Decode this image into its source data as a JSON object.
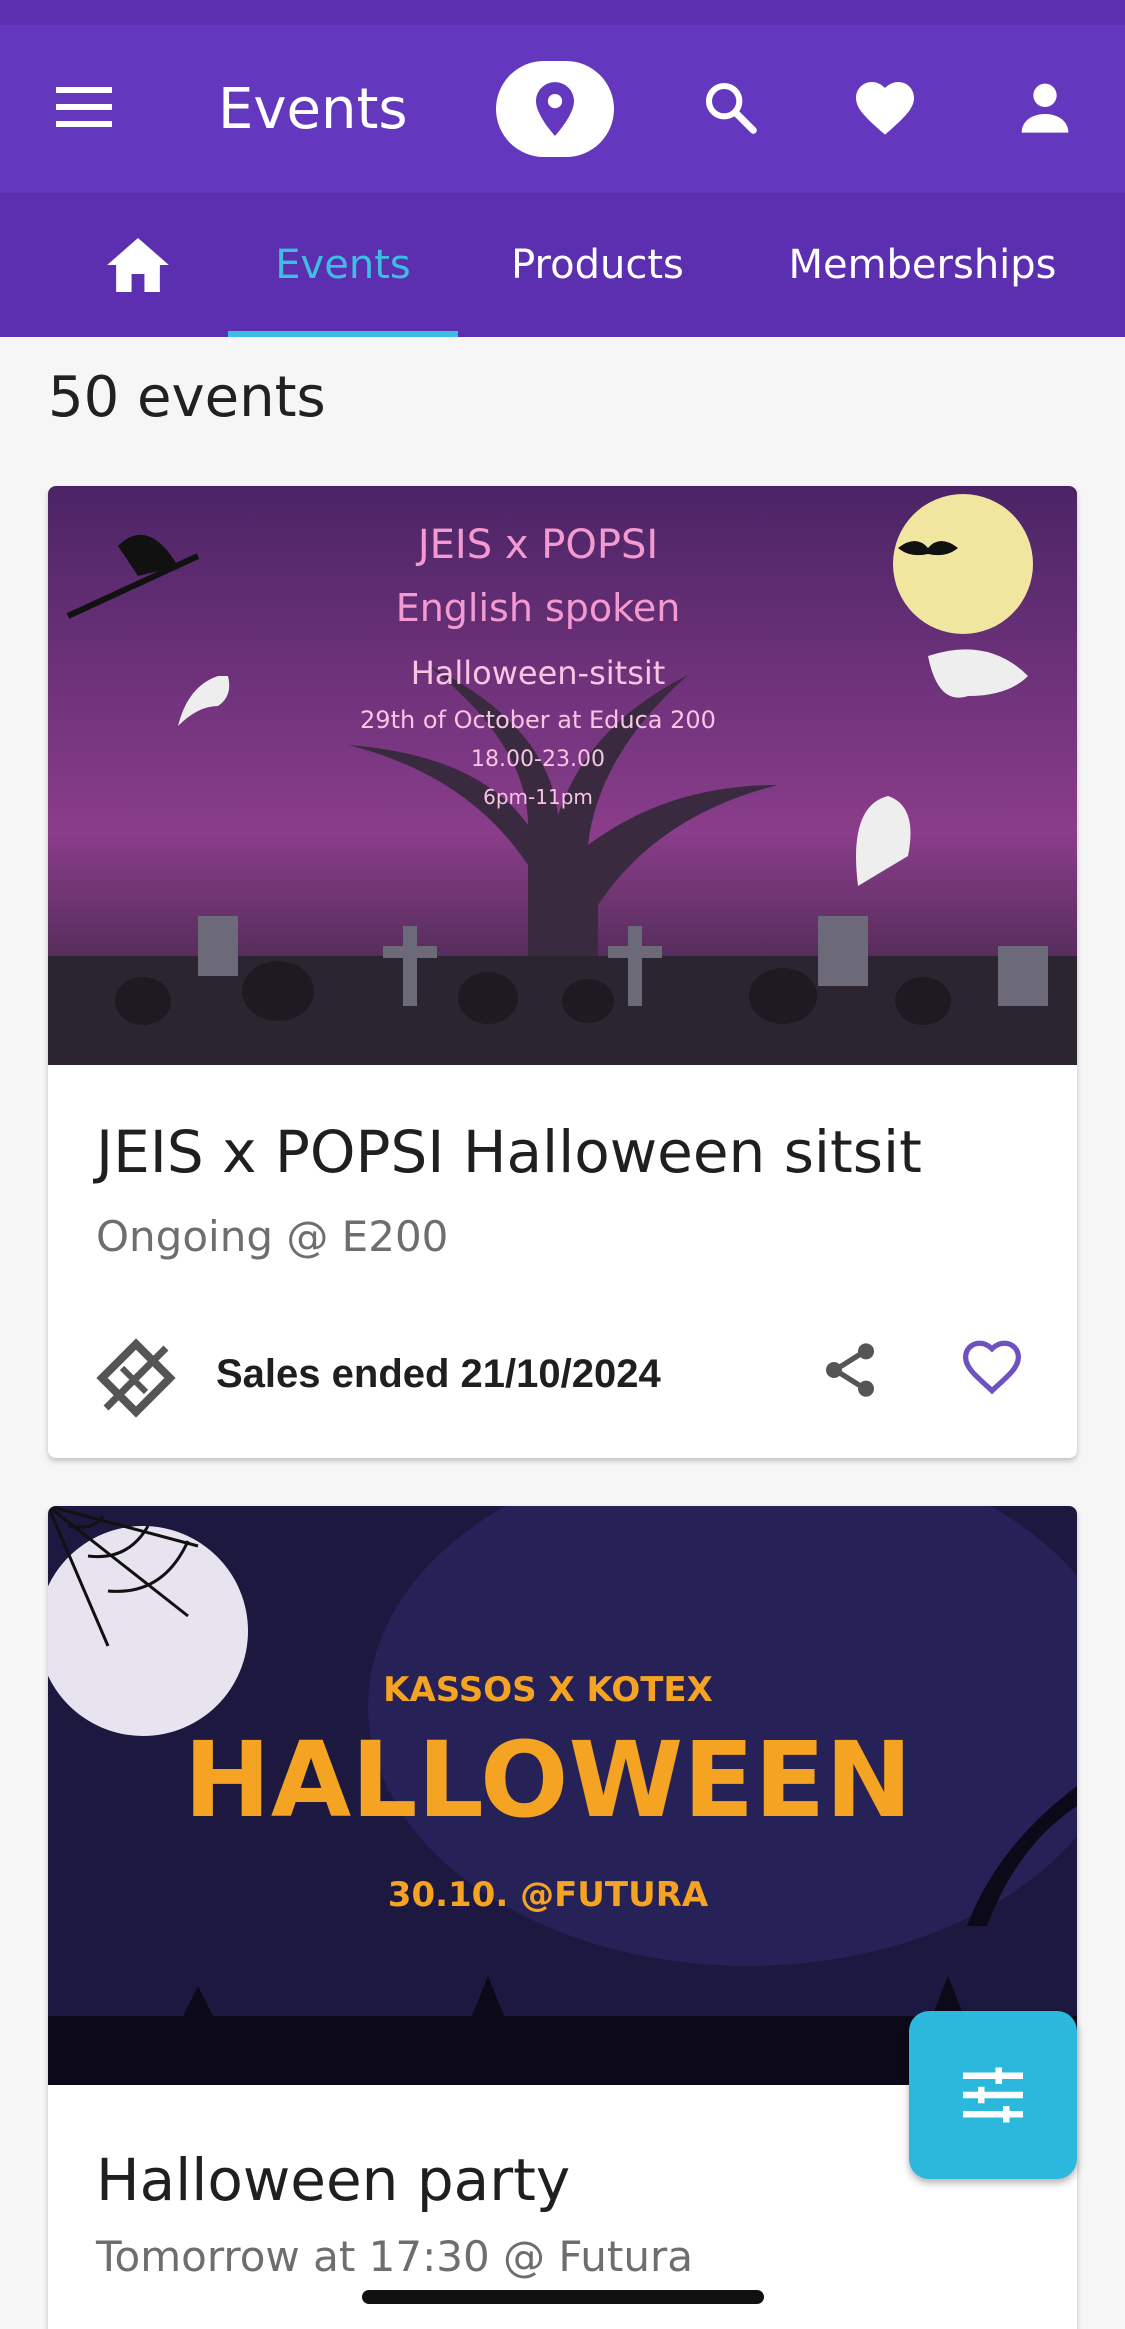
{
  "appbar": {
    "title": "Events",
    "icons": [
      "menu-icon",
      "location-pin-icon",
      "search-icon",
      "heart-icon",
      "person-icon"
    ]
  },
  "tabs": {
    "home_icon": "home-icon",
    "items": [
      {
        "label": "Events",
        "active": true
      },
      {
        "label": "Products",
        "active": false
      },
      {
        "label": "Memberships",
        "active": false
      }
    ]
  },
  "list": {
    "count": "50 events"
  },
  "events": [
    {
      "banner": {
        "line1": "JEIS x POPSI",
        "line2": "English spoken",
        "line3": "Halloween-sitsit",
        "line4": "29th of October at Educa 200",
        "line5": "18.00-23.00",
        "line6": "6pm-11pm"
      },
      "title": "JEIS x POPSI Halloween sitsit",
      "subtitle": "Ongoing @ E200",
      "sales_status": "Sales ended 21/10/2024"
    },
    {
      "banner": {
        "line1": "KASSOS X KOTEX",
        "line2": "HALLOWEEN",
        "line3": "30.10. @FUTURA"
      },
      "title": "Halloween party",
      "subtitle": "Tomorrow at 17:30 @ Futura"
    }
  ],
  "colors": {
    "appbar": "#6338bf",
    "tabbar": "#5b2fb0",
    "accent": "#3dbde0",
    "fab": "#2bb8dc"
  }
}
